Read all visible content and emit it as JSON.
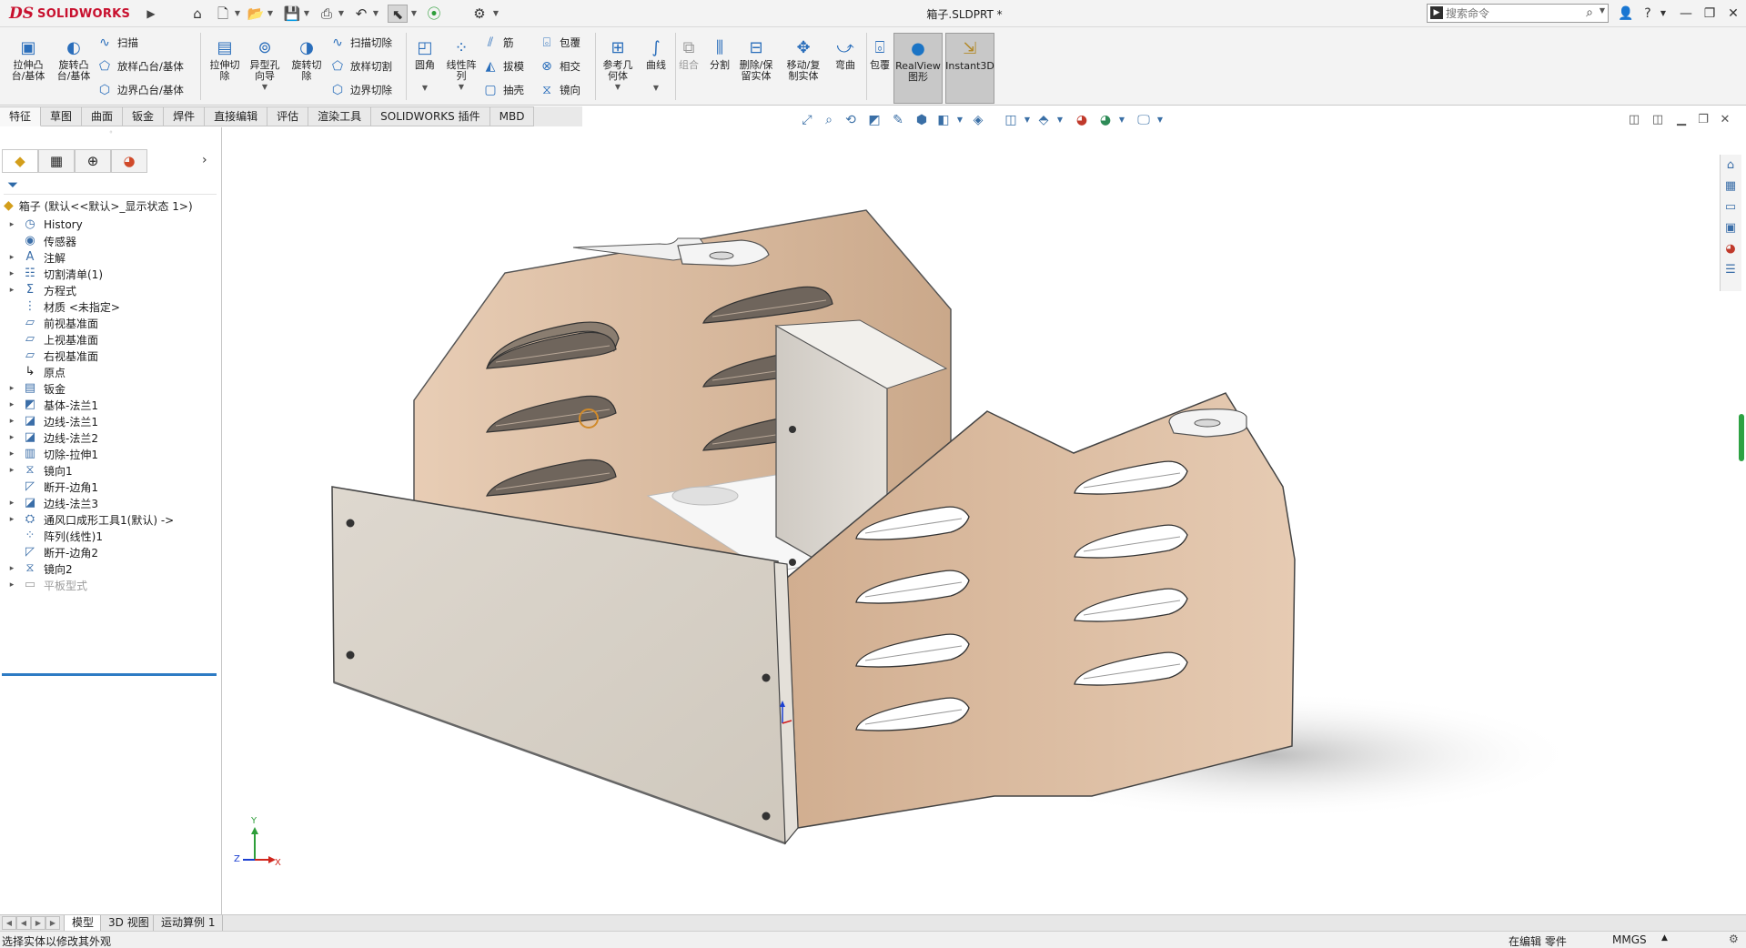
{
  "titlebar": {
    "brand_ds": "DS",
    "brand_name": "SOLIDWORKS",
    "document_title": "箱子.SLDPRT *",
    "search_placeholder": "搜索命令",
    "icons": [
      "home-icon",
      "new-document-icon",
      "open-icon",
      "save-icon",
      "print-icon",
      "undo-icon",
      "select-icon",
      "traffic-light-icon",
      "options-gear-icon",
      "user-icon",
      "help-icon",
      "minimize-icon",
      "restore-icon",
      "close-icon"
    ]
  },
  "ribbon": {
    "features": {
      "extruded_boss": "拉伸凸\n台/基体",
      "revolved_boss": "旋转凸\n台/基体",
      "swept_boss": "扫描",
      "lofted_boss": "放样凸台/基体",
      "boundary_boss": "边界凸台/基体",
      "extruded_cut": "拉伸切\n除",
      "hole_wizard": "异型孔\n向导",
      "revolved_cut": "旋转切\n除",
      "swept_cut": "扫描切除",
      "lofted_cut": "放样切割",
      "boundary_cut": "边界切除",
      "fillet": "圆角",
      "linear_pattern": "线性阵\n列",
      "rib": "筋",
      "draft": "拔模",
      "shell": "抽壳",
      "wrap": "包覆",
      "intersect": "相交",
      "mirror": "镜向",
      "reference_geometry": "参考几\n何体",
      "curves": "曲线",
      "combine": "组合",
      "split": "分割",
      "delete_keep_body": "删除/保\n留实体",
      "move_copy_body": "移动/复\n制实体",
      "flex": "弯曲",
      "wrap2": "包覆",
      "realview": "RealView\n图形",
      "instant3d": "Instant3D"
    }
  },
  "command_tabs": [
    "特征",
    "草图",
    "曲面",
    "钣金",
    "焊件",
    "直接编辑",
    "评估",
    "渲染工具",
    "SOLIDWORKS 插件",
    "MBD"
  ],
  "feature_tree": {
    "root": "箱子  (默认<<默认>_显示状态 1>)",
    "items": [
      {
        "label": "History",
        "icon": "history-icon"
      },
      {
        "label": "传感器",
        "icon": "sensor-icon"
      },
      {
        "label": "注解",
        "icon": "annotation-icon"
      },
      {
        "label": "切割清单(1)",
        "icon": "cut-list-icon"
      },
      {
        "label": "方程式",
        "icon": "equation-icon"
      },
      {
        "label": "材质 <未指定>",
        "icon": "material-icon"
      },
      {
        "label": "前视基准面",
        "icon": "plane-icon"
      },
      {
        "label": "上视基准面",
        "icon": "plane-icon"
      },
      {
        "label": "右视基准面",
        "icon": "plane-icon"
      },
      {
        "label": "原点",
        "icon": "origin-icon"
      },
      {
        "label": "钣金",
        "icon": "sheet-metal-icon"
      },
      {
        "label": "基体-法兰1",
        "icon": "base-flange-icon"
      },
      {
        "label": "边线-法兰1",
        "icon": "edge-flange-icon"
      },
      {
        "label": "边线-法兰2",
        "icon": "edge-flange-icon"
      },
      {
        "label": "切除-拉伸1",
        "icon": "extruded-cut-icon"
      },
      {
        "label": "镜向1",
        "icon": "mirror-icon"
      },
      {
        "label": "断开-边角1",
        "icon": "break-corner-icon"
      },
      {
        "label": "边线-法兰3",
        "icon": "edge-flange-icon"
      },
      {
        "label": "通风口成形工具1(默认) ->",
        "icon": "forming-tool-icon"
      },
      {
        "label": "阵列(线性)1",
        "icon": "linear-pattern-icon"
      },
      {
        "label": "断开-边角2",
        "icon": "break-corner-icon"
      },
      {
        "label": "镜向2",
        "icon": "mirror-icon"
      },
      {
        "label": "平板型式",
        "icon": "flat-pattern-icon"
      }
    ]
  },
  "bottom_tabs": [
    "模型",
    "3D 视图",
    "运动算例 1"
  ],
  "status_bar": {
    "message": "选择实体以修改其外观",
    "state": "在编辑 零件",
    "units": "MMGS"
  },
  "triad": {
    "x": "X",
    "y": "Y",
    "z": "Z"
  },
  "colors": {
    "sheet_metal_face": "#d9b99c",
    "front_wall": "#d8d2c9",
    "accent_blue": "#2a6ebb",
    "brand_red": "#c8102e"
  }
}
